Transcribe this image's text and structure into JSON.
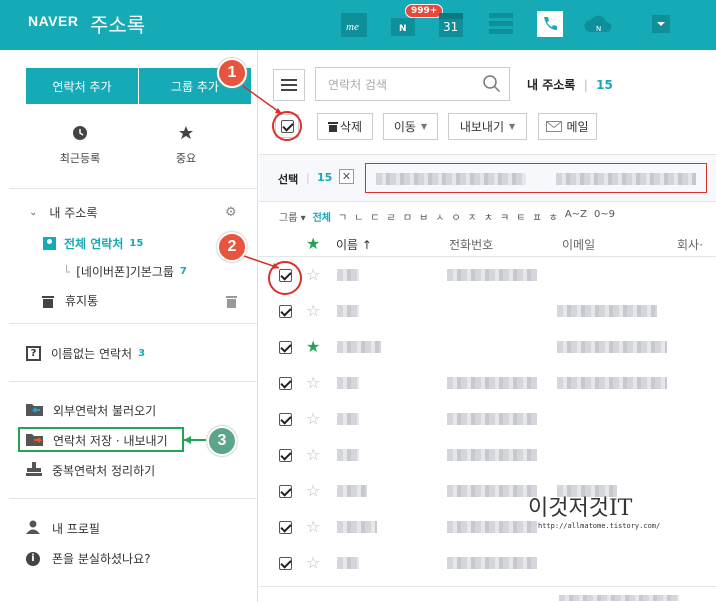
{
  "header": {
    "brand": "NAVER",
    "title": "주소록",
    "badge": "999+",
    "calendar_day": "31",
    "colors": {
      "bg": "#16aab7"
    }
  },
  "sidebar": {
    "add_contact": "연락처 추가",
    "add_group": "그룹 추가",
    "recent": "최근등록",
    "important": "중요",
    "my_book": "내 주소록",
    "all_contacts": "전체 연락처",
    "all_count": "15",
    "group": "[네이버폰]기본그룹",
    "group_count": "7",
    "trash": "휴지통",
    "no_name": "이름없는 연락처",
    "no_name_count": "3",
    "import": "외부연락처 불러오기",
    "export": "연락처 저장 · 내보내기",
    "dedupe": "중복연락처 정리하기",
    "profile": "내 프로필",
    "lost_phone": "폰을 분실하셨나요?"
  },
  "main": {
    "search_placeholder": "연락처 검색",
    "my_book": "내 주소록",
    "my_book_count": "15",
    "delete": "삭제",
    "move": "이동",
    "export": "내보내기",
    "mail": "메일",
    "selected_label": "선택",
    "selected_count": "15",
    "group_filter": "그룹",
    "alphabet": [
      "전체",
      "ㄱ",
      "ㄴ",
      "ㄷ",
      "ㄹ",
      "ㅁ",
      "ㅂ",
      "ㅅ",
      "ㅇ",
      "ㅈ",
      "ㅊ",
      "ㅋ",
      "ㅌ",
      "ㅍ",
      "ㅎ",
      "A~Z",
      "0~9"
    ],
    "col_name": "이름",
    "col_phone": "전화번호",
    "col_email": "이메일",
    "col_company": "회사·"
  },
  "annotations": [
    "1",
    "2",
    "3"
  ],
  "watermark": {
    "title": "이것저것IT",
    "url": "http://allmatome.tistory.com/"
  }
}
